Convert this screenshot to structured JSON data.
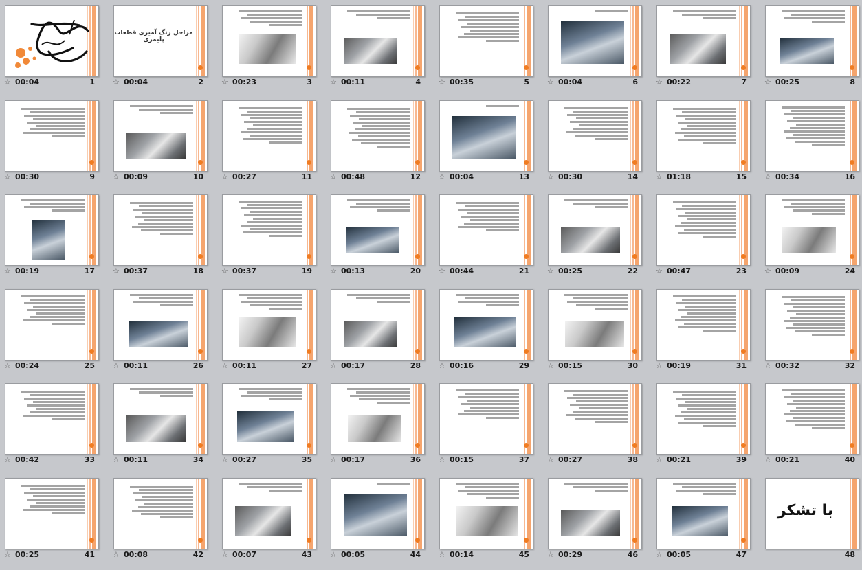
{
  "accent_color": "#f07c22",
  "icons": {
    "transition": "transition-star-icon"
  },
  "title_slide_text": "مراحل رنگ آمیزی قطعات پلیمری",
  "thanks_text": "با تشکر",
  "slides": [
    {
      "number": "1",
      "time": "00:04",
      "kind": "calligraphy"
    },
    {
      "number": "2",
      "time": "00:04",
      "kind": "title"
    },
    {
      "number": "3",
      "time": "00:23",
      "kind": "text-photo"
    },
    {
      "number": "4",
      "time": "00:11",
      "kind": "text-photo"
    },
    {
      "number": "5",
      "time": "00:35",
      "kind": "text"
    },
    {
      "number": "6",
      "time": "00:04",
      "kind": "photo-top"
    },
    {
      "number": "7",
      "time": "00:22",
      "kind": "text-photo"
    },
    {
      "number": "8",
      "time": "00:25",
      "kind": "text-photo"
    },
    {
      "number": "9",
      "time": "00:30",
      "kind": "text"
    },
    {
      "number": "10",
      "time": "00:09",
      "kind": "text-photo"
    },
    {
      "number": "11",
      "time": "00:27",
      "kind": "text"
    },
    {
      "number": "12",
      "time": "00:48",
      "kind": "text"
    },
    {
      "number": "13",
      "time": "00:04",
      "kind": "photo-top"
    },
    {
      "number": "14",
      "time": "00:30",
      "kind": "text"
    },
    {
      "number": "15",
      "time": "01:18",
      "kind": "text"
    },
    {
      "number": "16",
      "time": "00:34",
      "kind": "text"
    },
    {
      "number": "17",
      "time": "00:19",
      "kind": "text-photo-small"
    },
    {
      "number": "18",
      "time": "00:37",
      "kind": "text"
    },
    {
      "number": "19",
      "time": "00:37",
      "kind": "text"
    },
    {
      "number": "20",
      "time": "00:13",
      "kind": "text-photo"
    },
    {
      "number": "21",
      "time": "00:44",
      "kind": "text"
    },
    {
      "number": "22",
      "time": "00:25",
      "kind": "text-photo"
    },
    {
      "number": "23",
      "time": "00:47",
      "kind": "text"
    },
    {
      "number": "24",
      "time": "00:09",
      "kind": "text-photo"
    },
    {
      "number": "25",
      "time": "00:24",
      "kind": "text"
    },
    {
      "number": "26",
      "time": "00:11",
      "kind": "text-photo"
    },
    {
      "number": "27",
      "time": "00:11",
      "kind": "text-photo"
    },
    {
      "number": "28",
      "time": "00:17",
      "kind": "text-photo"
    },
    {
      "number": "29",
      "time": "00:16",
      "kind": "text-photo"
    },
    {
      "number": "30",
      "time": "00:15",
      "kind": "text-photo"
    },
    {
      "number": "31",
      "time": "00:19",
      "kind": "text"
    },
    {
      "number": "32",
      "time": "00:32",
      "kind": "text"
    },
    {
      "number": "33",
      "time": "00:42",
      "kind": "text"
    },
    {
      "number": "34",
      "time": "00:11",
      "kind": "text-photo"
    },
    {
      "number": "35",
      "time": "00:27",
      "kind": "text-photo"
    },
    {
      "number": "36",
      "time": "00:17",
      "kind": "text-photo"
    },
    {
      "number": "37",
      "time": "00:15",
      "kind": "text"
    },
    {
      "number": "38",
      "time": "00:27",
      "kind": "text"
    },
    {
      "number": "39",
      "time": "00:21",
      "kind": "text"
    },
    {
      "number": "40",
      "time": "00:21",
      "kind": "text"
    },
    {
      "number": "41",
      "time": "00:25",
      "kind": "text"
    },
    {
      "number": "42",
      "time": "00:08",
      "kind": "text"
    },
    {
      "number": "43",
      "time": "00:07",
      "kind": "text-photo"
    },
    {
      "number": "44",
      "time": "00:05",
      "kind": "photo-top"
    },
    {
      "number": "45",
      "time": "00:14",
      "kind": "text-photo"
    },
    {
      "number": "46",
      "time": "00:29",
      "kind": "text-photo"
    },
    {
      "number": "47",
      "time": "00:05",
      "kind": "text-photo"
    },
    {
      "number": "48",
      "time": "",
      "kind": "thanks"
    }
  ]
}
